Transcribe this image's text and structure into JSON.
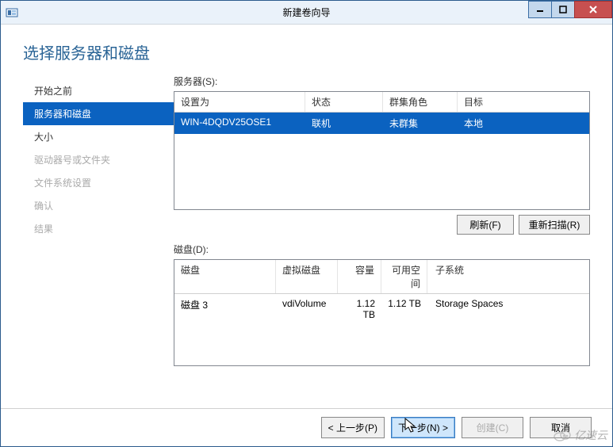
{
  "window": {
    "title": "新建卷向导"
  },
  "page": {
    "heading": "选择服务器和磁盘"
  },
  "nav": {
    "items": [
      {
        "label": "开始之前",
        "state": "done"
      },
      {
        "label": "服务器和磁盘",
        "state": "active"
      },
      {
        "label": "大小",
        "state": "done"
      },
      {
        "label": "驱动器号或文件夹",
        "state": "disabled"
      },
      {
        "label": "文件系统设置",
        "state": "disabled"
      },
      {
        "label": "确认",
        "state": "disabled"
      },
      {
        "label": "结果",
        "state": "disabled"
      }
    ]
  },
  "servers": {
    "label": "服务器(S):",
    "columns": {
      "provision": "设置为",
      "status": "状态",
      "role": "群集角色",
      "target": "目标"
    },
    "rows": [
      {
        "provision": "WIN-4DQDV25OSE1",
        "status": "联机",
        "role": "未群集",
        "target": "本地",
        "selected": true
      }
    ]
  },
  "buttons": {
    "refresh": "刷新(F)",
    "rescan": "重新扫描(R)"
  },
  "disks": {
    "label": "磁盘(D):",
    "columns": {
      "disk": "磁盘",
      "vdisk": "虚拟磁盘",
      "capacity": "容量",
      "free": "可用空间",
      "subsystem": "子系统"
    },
    "rows": [
      {
        "disk": "磁盘 3",
        "vdisk": "vdiVolume",
        "capacity": "1.12 TB",
        "free": "1.12 TB",
        "subsystem": "Storage Spaces"
      }
    ]
  },
  "footer": {
    "prev": "< 上一步(P)",
    "next": "下一步(N) >",
    "create": "创建(C)",
    "cancel": "取消"
  },
  "watermark": "亿速云"
}
